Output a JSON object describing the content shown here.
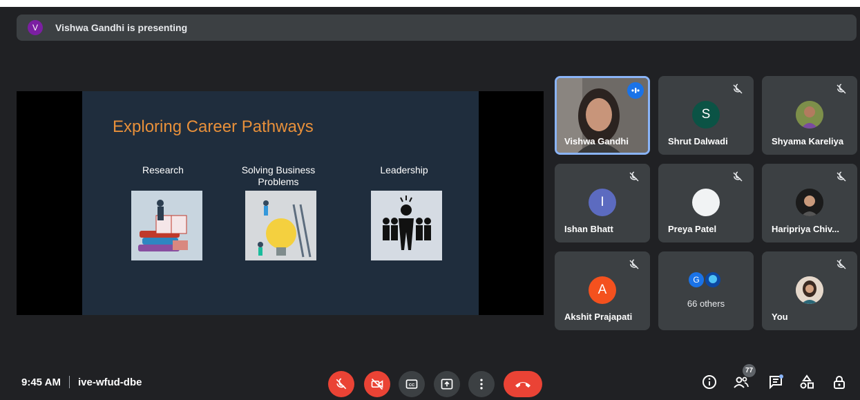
{
  "presenting": {
    "avatar_letter": "V",
    "text": "Vishwa Gandhi is presenting"
  },
  "slide": {
    "title": "Exploring Career Pathways",
    "columns": [
      "Research",
      "Solving Business Problems",
      "Leadership"
    ]
  },
  "participants": [
    {
      "name": "Vishwa Gandhi",
      "type": "video",
      "speaking": true
    },
    {
      "name": "Shrut Dalwadi",
      "type": "letter",
      "letter": "S",
      "color": "#0b5345",
      "muted": true
    },
    {
      "name": "Shyama Kareliya",
      "type": "photo",
      "muted": true
    },
    {
      "name": "Ishan Bhatt",
      "type": "letter",
      "letter": "I",
      "color": "#5c6bc0",
      "muted": true
    },
    {
      "name": "Preya Patel",
      "type": "blank",
      "muted": true
    },
    {
      "name": "Haripriya Chiv...",
      "type": "photo",
      "muted": true
    },
    {
      "name": "Akshit Prajapati",
      "type": "letter",
      "letter": "A",
      "color": "#f4511e",
      "muted": true
    },
    {
      "name": "66 others",
      "type": "group",
      "letter": "G"
    },
    {
      "name": "You",
      "type": "photo",
      "muted": true
    }
  ],
  "meeting": {
    "time": "9:45 AM",
    "code": "ive-wfud-dbe"
  },
  "people_count": "77",
  "controls": [
    "mic-off",
    "camera-off",
    "captions",
    "present",
    "more",
    "leave"
  ],
  "colors": {
    "accent_red": "#ea4335",
    "panel": "#3c4043",
    "background": "#202124",
    "highlight": "#8ab4f8"
  }
}
